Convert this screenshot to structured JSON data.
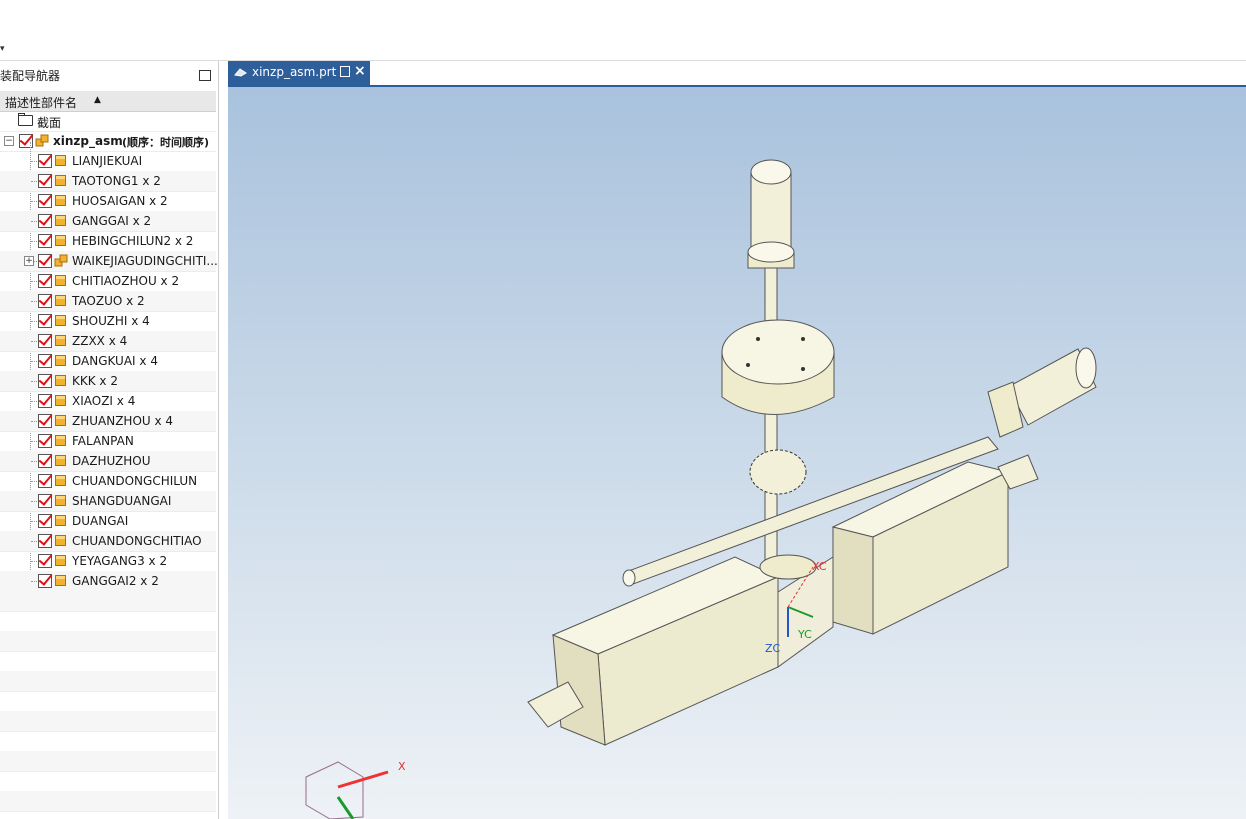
{
  "navigator": {
    "title": "装配导航器",
    "column_header": "描述性部件名",
    "sections_label": "截面",
    "root": {
      "name": "xinzp_asm",
      "order_label": "(顺序：时间顺序)"
    },
    "components": [
      {
        "label": "LIANJIEKUAI",
        "type": "part"
      },
      {
        "label": "TAOTONG1 x 2",
        "type": "part"
      },
      {
        "label": "HUOSAIGAN x 2",
        "type": "part"
      },
      {
        "label": "GANGGAI x 2",
        "type": "part"
      },
      {
        "label": "HEBINGCHILUN2 x 2",
        "type": "part"
      },
      {
        "label": "WAIKEJIAGUDINGCHITI...",
        "type": "subassembly"
      },
      {
        "label": "CHITIAOZHOU x 2",
        "type": "part"
      },
      {
        "label": "TAOZUO x 2",
        "type": "part"
      },
      {
        "label": "SHOUZHI x 4",
        "type": "part"
      },
      {
        "label": "ZZXX x 4",
        "type": "part"
      },
      {
        "label": "DANGKUAI x 4",
        "type": "part"
      },
      {
        "label": "KKK x 2",
        "type": "part"
      },
      {
        "label": "XIAOZI x 4",
        "type": "part"
      },
      {
        "label": "ZHUANZHOU x 4",
        "type": "part"
      },
      {
        "label": "FALANPAN",
        "type": "part"
      },
      {
        "label": "DAZHUZHOU",
        "type": "part"
      },
      {
        "label": "CHUANDONGCHILUN",
        "type": "part"
      },
      {
        "label": "SHANGDUANGAI",
        "type": "part"
      },
      {
        "label": "DUANGAI",
        "type": "part"
      },
      {
        "label": "CHUANDONGCHITIAO",
        "type": "part"
      },
      {
        "label": "YEYAGANG3 x 2",
        "type": "part"
      },
      {
        "label": "GANGGAI2 x 2",
        "type": "part"
      }
    ]
  },
  "document_tab": {
    "title": "xinzp_asm.prt"
  },
  "viewport": {
    "wcs_labels": {
      "xc": "XC",
      "yc": "YC",
      "zc": "ZC"
    },
    "triad_x_label": "X"
  },
  "colors": {
    "tab_blue": "#2f5f9a",
    "model_body": "#f3f0da",
    "check_red": "#d11111",
    "part_orange": "#f2b12e"
  }
}
